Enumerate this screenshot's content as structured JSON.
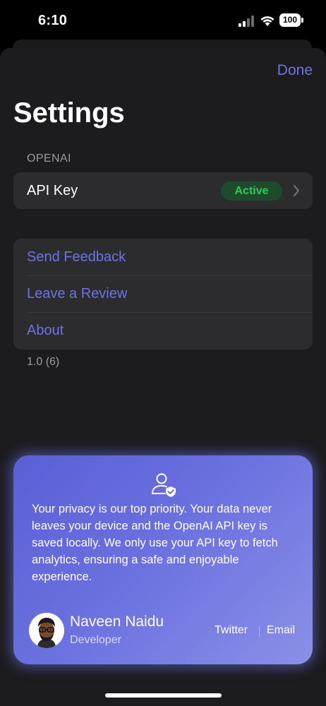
{
  "status_bar": {
    "time": "6:10",
    "battery": "100"
  },
  "nav": {
    "done_label": "Done"
  },
  "page": {
    "title": "Settings"
  },
  "openai_section": {
    "header": "OPENAI",
    "api_key_label": "API Key",
    "status_badge": "Active"
  },
  "links": [
    {
      "label": "Send Feedback"
    },
    {
      "label": "Leave a Review"
    },
    {
      "label": "About"
    }
  ],
  "version": "1.0 (6)",
  "privacy_card": {
    "icon": "user-shield-icon",
    "text": "Your privacy is our top priority. Your data never leaves your device and the OpenAI API key is saved locally. We only use your API key to fetch analytics, ensuring a safe and enjoyable experience.",
    "developer_name": "Naveen Naidu",
    "developer_role": "Developer",
    "twitter_label": "Twitter",
    "email_label": "Email"
  },
  "colors": {
    "accent": "#6d73e6",
    "active_green": "#34c759",
    "background": "#1c1c1e",
    "card_gradient_start": "#5b5fd6",
    "card_gradient_end": "#8a90e6"
  }
}
